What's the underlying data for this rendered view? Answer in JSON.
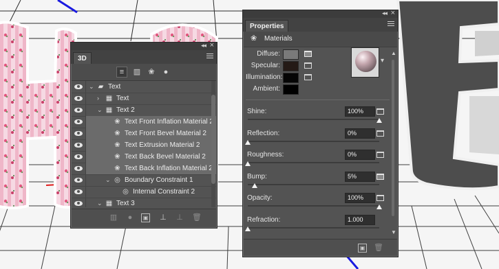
{
  "panel_3d": {
    "title": "3D",
    "filter_buttons": [
      {
        "icon": "whole-scene-icon",
        "glyph": "≡"
      },
      {
        "icon": "meshes-icon",
        "glyph": "▥"
      },
      {
        "icon": "materials-icon",
        "glyph": "❀"
      },
      {
        "icon": "lights-icon",
        "glyph": "●"
      }
    ],
    "layers": [
      {
        "name": "Text",
        "depth": 0,
        "expanded": true,
        "icon": "folder-icon",
        "glyph": "▰",
        "selected": false
      },
      {
        "name": "Text",
        "depth": 1,
        "expanded": false,
        "icon": "mesh-icon",
        "glyph": "▦",
        "selected": false
      },
      {
        "name": "Text 2",
        "depth": 1,
        "expanded": true,
        "icon": "mesh-icon",
        "glyph": "▦",
        "selected": false
      },
      {
        "name": "Text Front Inflation Material 2",
        "depth": 2,
        "icon": "material-icon",
        "glyph": "❀",
        "selected": true
      },
      {
        "name": "Text Front Bevel Material 2",
        "depth": 2,
        "icon": "material-icon",
        "glyph": "❀",
        "selected": true
      },
      {
        "name": "Text Extrusion Material 2",
        "depth": 2,
        "icon": "material-icon",
        "glyph": "❀",
        "selected": true
      },
      {
        "name": "Text Back Bevel Material 2",
        "depth": 2,
        "icon": "material-icon",
        "glyph": "❀",
        "selected": true
      },
      {
        "name": "Text Back Inflation Material 2",
        "depth": 2,
        "icon": "material-icon",
        "glyph": "❀",
        "selected": true
      },
      {
        "name": "Boundary Constraint 1",
        "depth": 2,
        "expanded": true,
        "icon": "constraint-icon",
        "glyph": "◎",
        "selected": false
      },
      {
        "name": "Internal Constraint 2",
        "depth": 3,
        "icon": "constraint-icon",
        "glyph": "◎",
        "selected": false
      },
      {
        "name": "Text 3",
        "depth": 1,
        "expanded": true,
        "icon": "mesh-icon",
        "glyph": "▦",
        "selected": false
      }
    ],
    "bottom_buttons": [
      {
        "icon": "add-mesh-icon",
        "glyph": "▥",
        "dim": true
      },
      {
        "icon": "add-light-icon",
        "glyph": "●",
        "dim": true
      },
      {
        "icon": "render-icon",
        "glyph": "▣",
        "dim": false,
        "boxed": true
      },
      {
        "icon": "drop-to-ground-icon",
        "glyph": "⊥",
        "dim": false
      },
      {
        "icon": "constraint-add-icon",
        "glyph": "⊥",
        "dim": true
      },
      {
        "icon": "trash-icon",
        "glyph": "🗑",
        "dim": true
      }
    ]
  },
  "properties": {
    "title": "Properties",
    "section": "Materials",
    "swatches": [
      {
        "label": "Diffuse:",
        "color": "#7a7a7a",
        "texture": true
      },
      {
        "label": "Specular:",
        "color": "#241a16",
        "texture": false
      },
      {
        "label": "Illumination:",
        "color": "#050505",
        "texture": false
      },
      {
        "label": "Ambient:",
        "color": "#000000",
        "texture": null
      }
    ],
    "sliders": [
      {
        "label": "Shine:",
        "value": "100%",
        "level": 1.0,
        "folder": "plain"
      },
      {
        "label": "Reflection:",
        "value": "0%",
        "level": 0.0,
        "folder": "plain"
      },
      {
        "label": "Roughness:",
        "value": "0%",
        "level": 0.0,
        "folder": "plain"
      },
      {
        "label": "Bump:",
        "value": "5%",
        "level": 0.05,
        "folder": "texture"
      },
      {
        "label": "Opacity:",
        "value": "100%",
        "level": 1.0,
        "folder": "plain"
      },
      {
        "label": "Refraction:",
        "value": "1.000",
        "level": 0.0,
        "folder": null
      }
    ]
  }
}
